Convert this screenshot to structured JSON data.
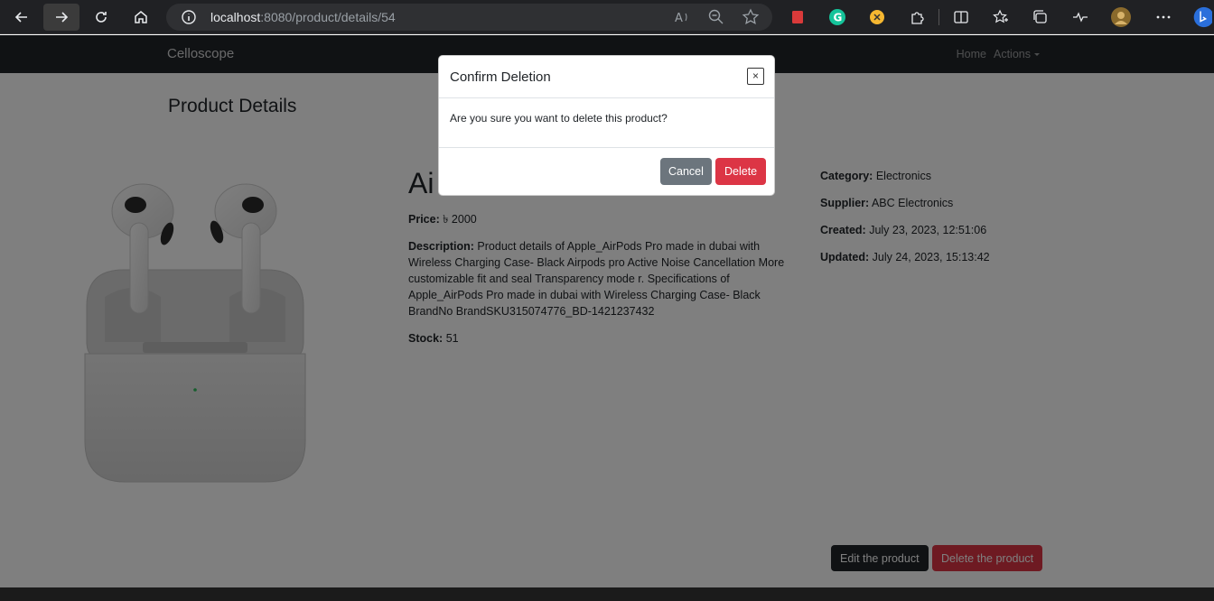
{
  "browser": {
    "url_host": "localhost",
    "url_path": ":8080/product/details/54"
  },
  "navbar": {
    "brand": "Celloscope",
    "links": [
      {
        "label": "Home"
      },
      {
        "label": "Actions"
      }
    ]
  },
  "page": {
    "title": "Product Details",
    "product_name": "Ai",
    "price_label": "Price:",
    "price_value": "৳ 2000",
    "description_label": "Description:",
    "description_value": "Product details of Apple_AirPods Pro made in dubai with Wireless Charging Case- Black Airpods pro Active Noise Cancellation More customizable fit and seal Transparency mode r. Specifications of Apple_AirPods Pro made in dubai with Wireless Charging Case- Black BrandNo BrandSKU315074776_BD-1421237432",
    "stock_label": "Stock:",
    "stock_value": "51",
    "category_label": "Category:",
    "category_value": "Electronics",
    "supplier_label": "Supplier:",
    "supplier_value": "ABC Electronics",
    "created_label": "Created:",
    "created_value": "July 23, 2023, 12:51:06",
    "updated_label": "Updated:",
    "updated_value": "July 24, 2023, 15:13:42",
    "edit_button": "Edit the product",
    "delete_button": "Delete the product"
  },
  "modal": {
    "title": "Confirm Deletion",
    "close": "×",
    "body": "Are you sure you want to delete this product?",
    "cancel": "Cancel",
    "delete": "Delete"
  },
  "colors": {
    "danger": "#dc3545",
    "secondary": "#6c757d",
    "dark": "#212529"
  }
}
